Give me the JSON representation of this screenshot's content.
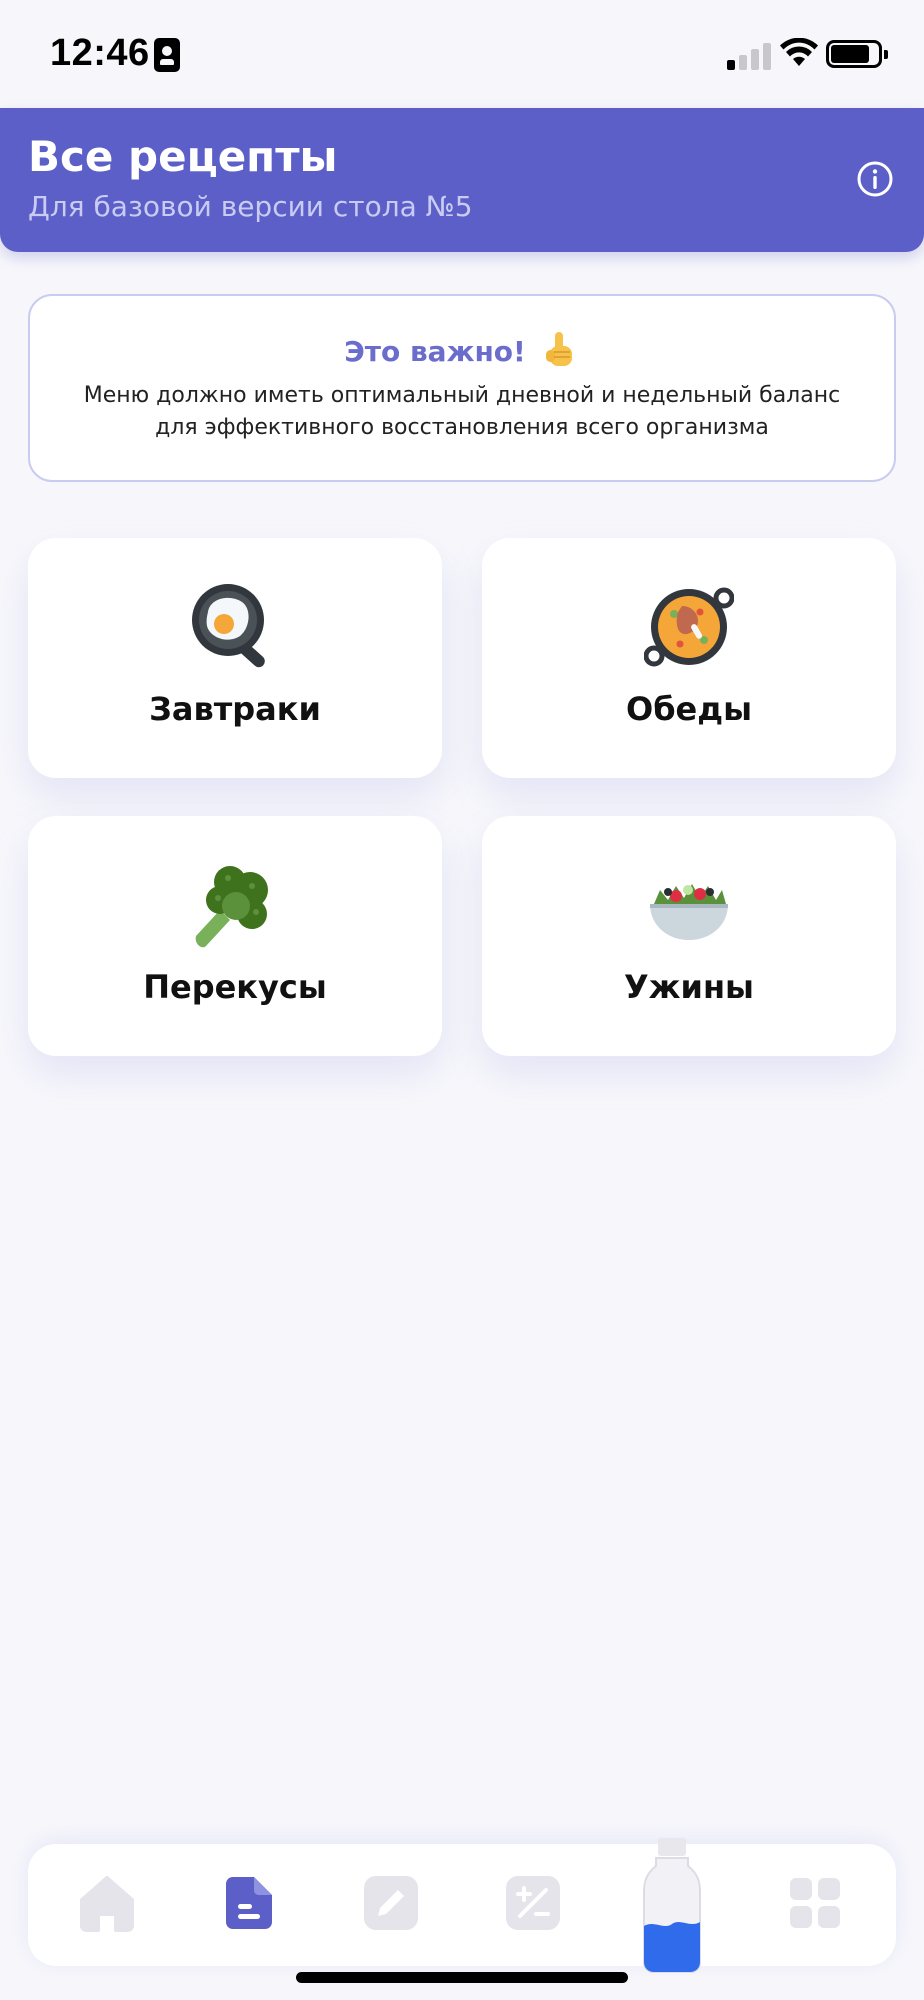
{
  "status_bar": {
    "time": "12:46"
  },
  "header": {
    "title": "Все рецепты",
    "subtitle": "Для базовой версии стола №5"
  },
  "notice": {
    "title": "Это важно!",
    "text": "Меню должно иметь оптимальный дневной и недельный баланс для эффективного восстановления всего организма"
  },
  "categories": [
    {
      "label": "Завтраки",
      "icon": "frying-pan-egg-icon"
    },
    {
      "label": "Обеды",
      "icon": "paella-pan-icon"
    },
    {
      "label": "Перекусы",
      "icon": "broccoli-icon"
    },
    {
      "label": "Ужины",
      "icon": "salad-bowl-icon"
    }
  ],
  "bottom_nav": {
    "items": [
      {
        "icon": "home-icon",
        "active": false
      },
      {
        "icon": "recipes-icon",
        "active": true
      },
      {
        "icon": "edit-icon",
        "active": false
      },
      {
        "icon": "calculator-icon",
        "active": false
      },
      {
        "icon": "water-bottle-icon",
        "active": false
      },
      {
        "icon": "apps-grid-icon",
        "active": false
      }
    ]
  },
  "colors": {
    "accent": "#5b5fc7",
    "background": "#f7f7fb",
    "inactive_icon": "#e4e4ea",
    "water": "#2f6bea"
  }
}
